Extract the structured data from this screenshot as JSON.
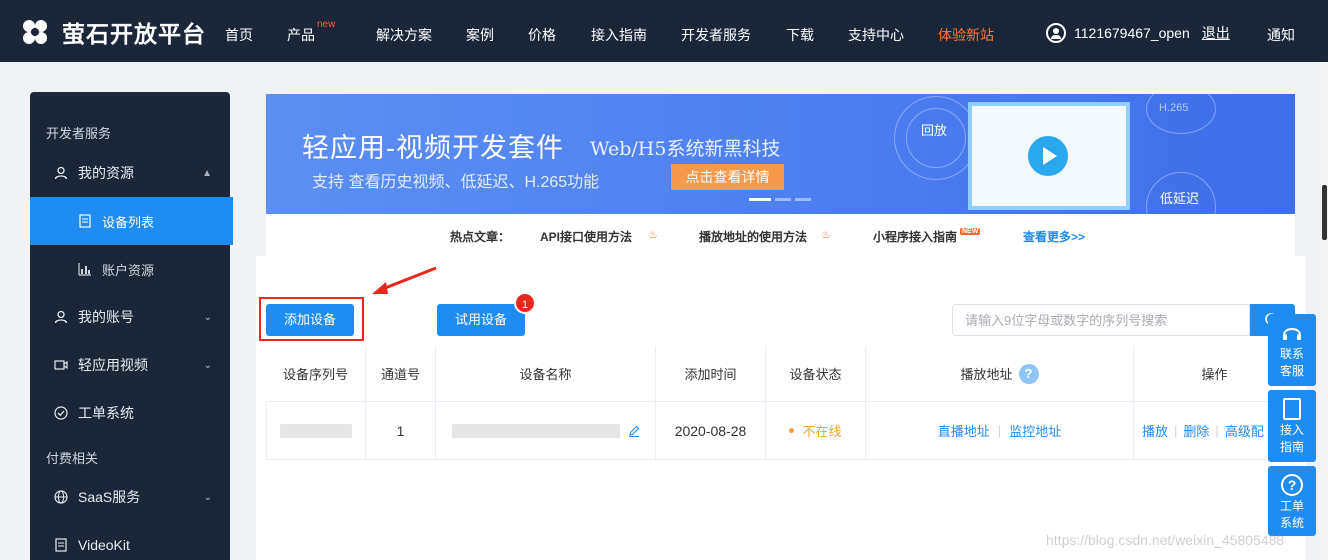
{
  "header": {
    "logo_text": "萤石开放平台",
    "nav": [
      {
        "label": "首页"
      },
      {
        "label": "产品",
        "badge": "new"
      },
      {
        "label": "解决方案"
      },
      {
        "label": "案例"
      },
      {
        "label": "价格"
      },
      {
        "label": "接入指南"
      },
      {
        "label": "开发者服务"
      },
      {
        "label": "下载"
      },
      {
        "label": "支持中心"
      },
      {
        "label": "体验新站"
      }
    ],
    "username": "1121679467_open",
    "logout": "退出",
    "notify": "通知"
  },
  "sidebar": {
    "section_dev": "开发者服务",
    "my_resources": "我的资源",
    "device_list": "设备列表",
    "account_resources": "账户资源",
    "my_account": "我的账号",
    "light_video": "轻应用视频",
    "ticket_system": "工单系统",
    "section_pay": "付费相关",
    "saas": "SaaS服务",
    "videokit": "VideoKit"
  },
  "banner": {
    "title": "轻应用-视频开发套件",
    "tagline": "Web/H5系统新黑科技",
    "subtitle": "支持 查看历史视频、低延迟、H.265功能",
    "cta": "点击查看详情",
    "label_replay": "回放",
    "label_h265": "H.265",
    "label_lowlatency": "低延迟"
  },
  "hot_articles": {
    "label": "热点文章：",
    "items": [
      "API接口使用方法",
      "播放地址的使用方法",
      "小程序接入指南"
    ],
    "new_badge": "NEW",
    "more": "查看更多>>"
  },
  "actions": {
    "add_device": "添加设备",
    "trial_device": "试用设备",
    "trial_badge": "1",
    "search_placeholder": "请输入9位字母或数字的序列号搜索"
  },
  "table": {
    "headers": [
      "设备序列号",
      "通道号",
      "设备名称",
      "添加时间",
      "设备状态",
      "播放地址",
      "操作"
    ],
    "rows": [
      {
        "channel": "1",
        "added": "2020-08-28",
        "status": "不在线",
        "play_live": "直播地址",
        "play_monitor": "监控地址",
        "op_play": "播放",
        "op_delete": "删除",
        "op_advanced": "高级配"
      }
    ]
  },
  "float_bar": [
    {
      "label": "联系客服"
    },
    {
      "label": "接入指南"
    },
    {
      "label": "工单系统"
    }
  ],
  "watermark": "https://blog.csdn.net/weixin_45805488",
  "colors": {
    "nav_bg": "#1b2738",
    "accent": "#1e8cf0",
    "highlight": "#ff7a2f",
    "offline": "#f2a23a",
    "annotation": "#e8271f"
  }
}
